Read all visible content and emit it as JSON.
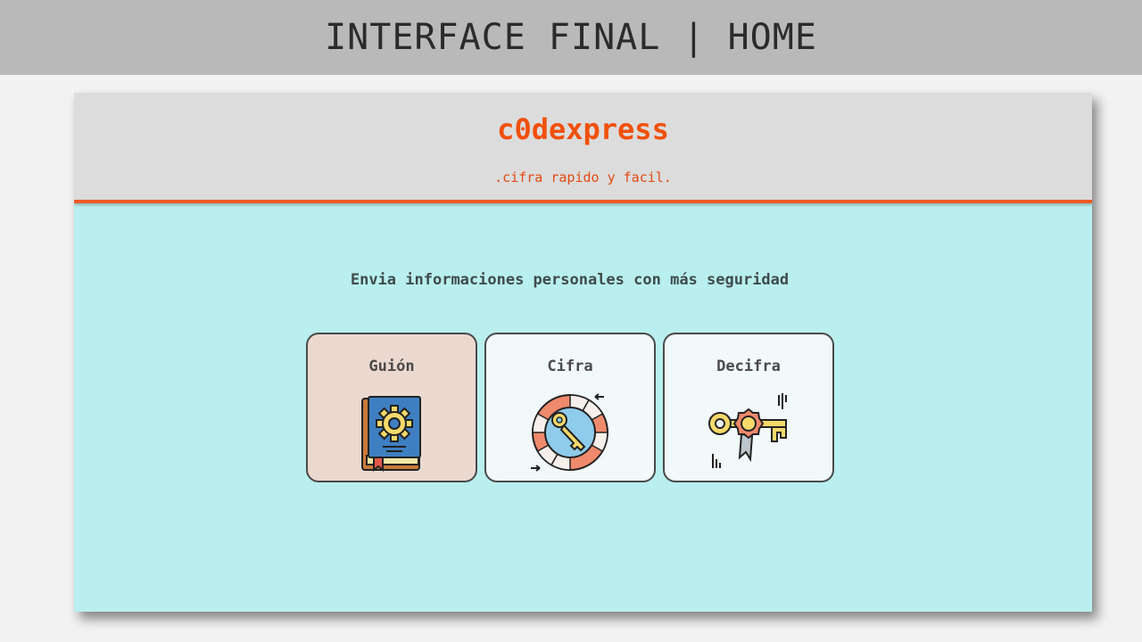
{
  "banner": {
    "title": "INTERFACE FINAL | HOME"
  },
  "app": {
    "brand": "c0dexpress",
    "tagline": ".cifra rapido y facil.",
    "headline": "Envia informaciones personales con más seguridad",
    "colors": {
      "accent": "#f0500a",
      "header_bg": "#dcdcdc",
      "body_bg": "#b9efee",
      "card_bg": "#f1f9fb",
      "card_selected_bg": "#ebd9d0"
    },
    "cards": [
      {
        "label": "Guión",
        "icon": "gear-book-icon",
        "selected": true
      },
      {
        "label": "Cifra",
        "icon": "key-wheel-icon",
        "selected": false
      },
      {
        "label": "Decifra",
        "icon": "key-ribbon-icon",
        "selected": false
      }
    ]
  }
}
